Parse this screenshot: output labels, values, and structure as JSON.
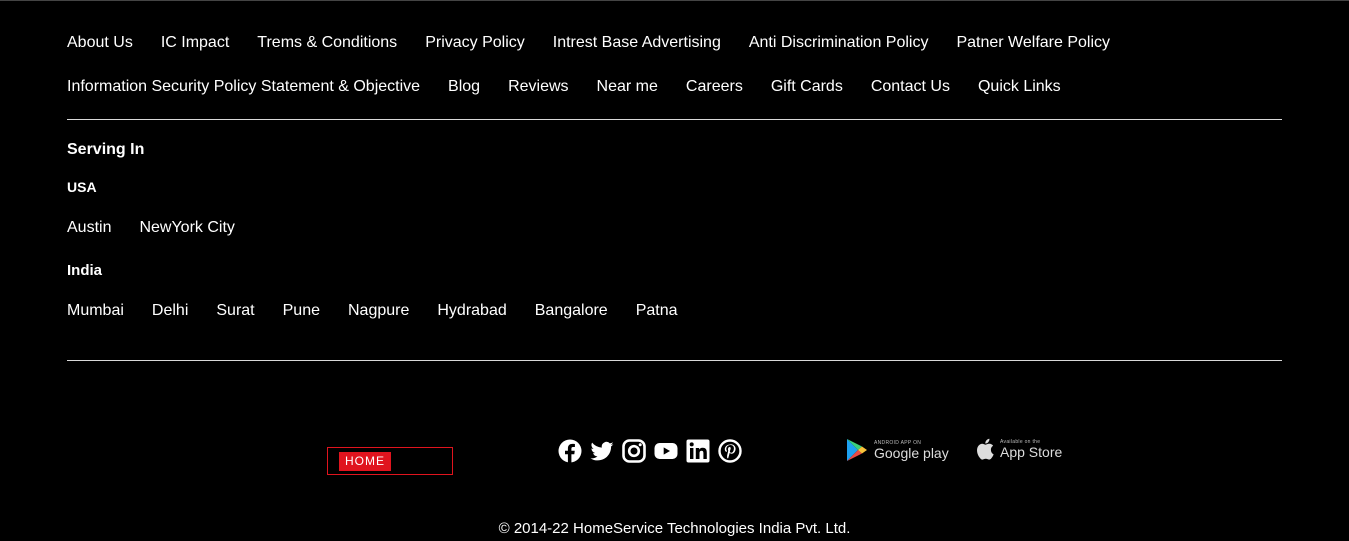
{
  "footer_links_row1": [
    "About Us",
    "IC Impact",
    "Trems & Conditions",
    "Privacy Policy",
    "Intrest Base Advertising",
    "Anti Discrimination Policy",
    "Patner Welfare Policy"
  ],
  "footer_links_row2": [
    "Information Security Policy Statement & Objective",
    "Blog",
    "Reviews",
    "Near me",
    "Careers",
    "Gift Cards",
    "Contact Us",
    "Quick Links"
  ],
  "serving": {
    "heading": "Serving In",
    "usa_label": "USA",
    "usa_cities": [
      "Austin",
      "NewYork City"
    ],
    "india_label": "India",
    "india_cities": [
      "Mumbai",
      "Delhi",
      "Surat",
      "Pune",
      "Nagpure",
      "Hydrabad",
      "Bangalore",
      "Patna"
    ]
  },
  "logo": {
    "text": "HOME"
  },
  "social_icons": [
    "facebook-icon",
    "twitter-icon",
    "instagram-icon",
    "youtube-icon",
    "linkedin-icon",
    "pinterest-icon"
  ],
  "stores": {
    "google": {
      "small": "ANDROID APP ON",
      "big": "Google play"
    },
    "apple": {
      "small": "Available on the",
      "big": "App Store"
    }
  },
  "copyright": "© 2014-22 HomeService Technologies India Pvt. Ltd.",
  "colors": {
    "background": "#000000",
    "text": "#ffffff",
    "accent": "#e0141e",
    "divider": "#d9d9d9"
  }
}
